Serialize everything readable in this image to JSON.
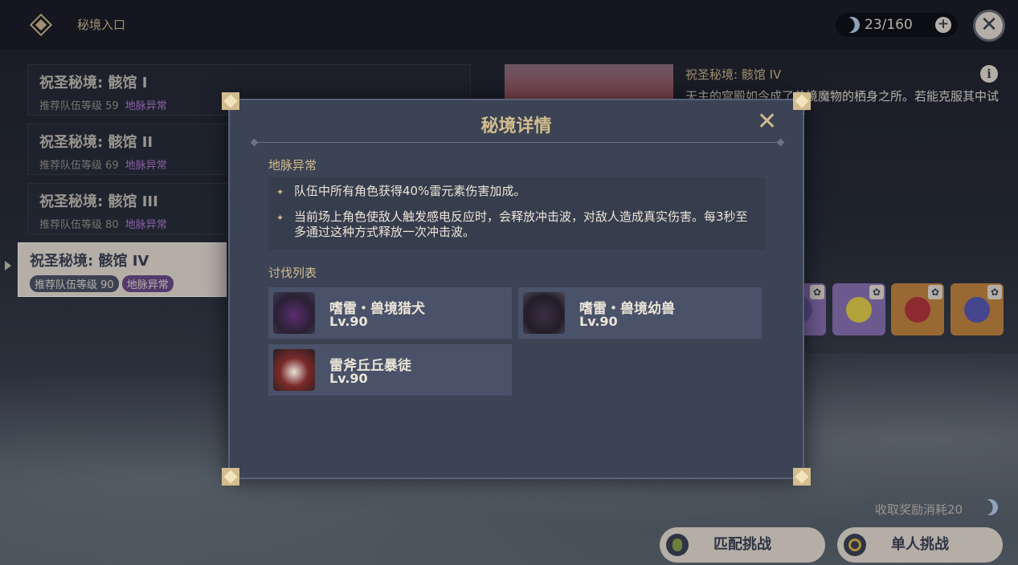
{
  "header": {
    "title": "秘境入口",
    "resin": "23/160"
  },
  "domains": [
    {
      "name": "祝圣秘境: 骸馆 I",
      "level": "推荐队伍等级 59",
      "tag": "地脉异常"
    },
    {
      "name": "祝圣秘境: 骸馆 II",
      "level": "推荐队伍等级 69",
      "tag": "地脉异常"
    },
    {
      "name": "祝圣秘境: 骸馆 III",
      "level": "推荐队伍等级 80",
      "tag": "地脉异常"
    },
    {
      "name": "祝圣秘境: 骸馆 IV",
      "level": "推荐队伍等级 90",
      "tag": "地脉异常"
    }
  ],
  "detail": {
    "title": "祝圣秘境: 骸馆 IV",
    "desc": "天主的宫殿如今成了兽境魔物的栖身之所。若能克服其中试炼者，或许就能获得珍"
  },
  "modal": {
    "title": "秘境详情",
    "abnormal_label": "地脉异常",
    "abnormal_items": [
      "队伍中所有角色获得40%雷元素伤害加成。",
      "当前场上角色使敌人触发感电反应时，会释放冲击波，对敌人造成真实伤害。每3秒至多通过这种方式释放一次冲击波。"
    ],
    "enemy_label": "讨伐列表",
    "enemies": [
      {
        "name": "嗜雷・兽境猎犬",
        "level": "Lv.90"
      },
      {
        "name": "嗜雷・兽境幼兽",
        "level": "Lv.90"
      },
      {
        "name": "雷斧丘丘暴徒",
        "level": "Lv.90"
      }
    ]
  },
  "footer": {
    "cost": "收取奖励消耗20",
    "match_label": "匹配挑战",
    "solo_label": "单人挑战"
  },
  "colors": {
    "accent": "#d3bc8e",
    "modal_bg": "#3b4354",
    "abnormal": "#b57cd8"
  }
}
